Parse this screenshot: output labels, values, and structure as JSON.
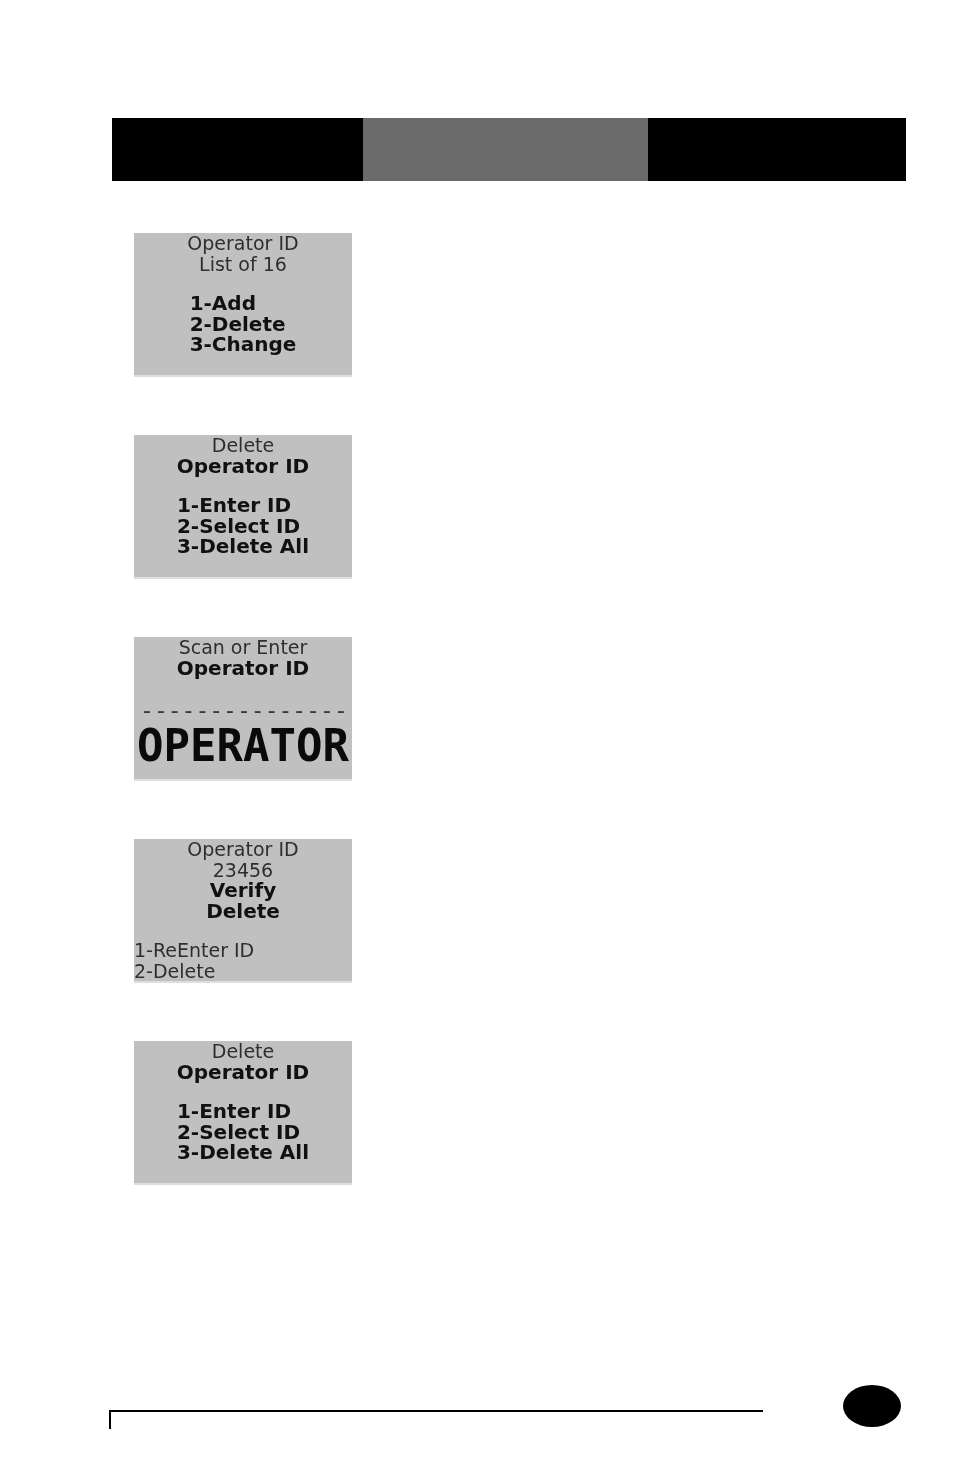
{
  "header_bar": {
    "segments": [
      {
        "selected": false
      },
      {
        "selected": true
      },
      {
        "selected": false
      }
    ]
  },
  "screens": [
    {
      "header": [
        {
          "text": "Operator ID",
          "kind": "regular"
        },
        {
          "text": "List of 16",
          "kind": "regular"
        }
      ],
      "flush_left": false,
      "body": [
        {
          "text": "1-Add",
          "kind": "bold"
        },
        {
          "text": "2-Delete",
          "kind": "bold"
        },
        {
          "text": "3-Change",
          "kind": "bold"
        }
      ]
    },
    {
      "header": [
        {
          "text": "Delete",
          "kind": "regular"
        },
        {
          "text": "Operator ID",
          "kind": "bold"
        }
      ],
      "flush_left": false,
      "body": [
        {
          "text": "1-Enter ID",
          "kind": "bold"
        },
        {
          "text": "2-Select ID",
          "kind": "bold"
        },
        {
          "text": "3-Delete All",
          "kind": "bold"
        }
      ]
    },
    {
      "header": [
        {
          "text": "Scan or Enter",
          "kind": "regular"
        },
        {
          "text": "Operator ID",
          "kind": "bold"
        }
      ],
      "flush_left": false,
      "body": [
        {
          "text": "---------------",
          "kind": "dashes"
        },
        {
          "text": "OPERATOR",
          "kind": "large"
        }
      ]
    },
    {
      "header": [
        {
          "text": "Operator ID",
          "kind": "regular"
        },
        {
          "text": "23456",
          "kind": "regular"
        },
        {
          "text": "Verify",
          "kind": "bold"
        },
        {
          "text": "Delete",
          "kind": "bold"
        }
      ],
      "flush_left": true,
      "body": [
        {
          "text": "1-ReEnter ID",
          "kind": "regular"
        },
        {
          "text": "2-Delete",
          "kind": "regular"
        }
      ]
    },
    {
      "header": [
        {
          "text": "Delete",
          "kind": "regular"
        },
        {
          "text": "Operator ID",
          "kind": "bold"
        }
      ],
      "flush_left": false,
      "body": [
        {
          "text": "1-Enter ID",
          "kind": "bold"
        },
        {
          "text": "2-Select ID",
          "kind": "bold"
        },
        {
          "text": "3-Delete All",
          "kind": "bold"
        }
      ]
    }
  ]
}
